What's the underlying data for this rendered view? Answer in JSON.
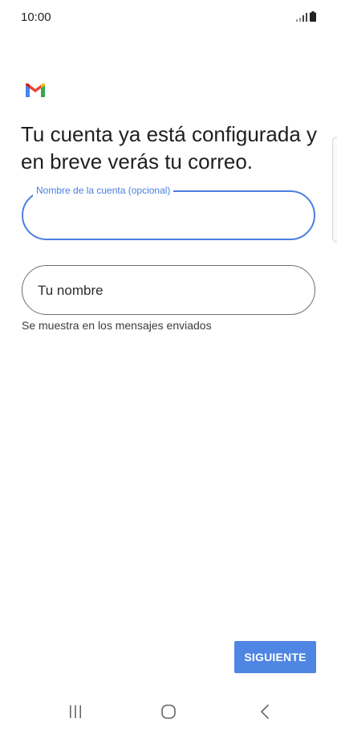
{
  "status_bar": {
    "time": "10:00",
    "icons": [
      "signal-icon",
      "battery-icon"
    ]
  },
  "app": {
    "logo": "gmail-logo-icon",
    "brand_colors": {
      "red": "#EA4335",
      "blue": "#4285F4",
      "green": "#34A853",
      "yellow": "#FBBC04"
    }
  },
  "main": {
    "headline": "Tu cuenta ya está configurada y en breve verás tu correo.",
    "account_field": {
      "label": "Nombre de la cuenta (opcional)",
      "value": ""
    },
    "name_field": {
      "placeholder": "Tu nombre",
      "value": "",
      "helper": "Se muestra en los mensajes enviados"
    },
    "next_button": "SIGUIENTE"
  },
  "nav_bar": {
    "buttons": [
      "recents-icon",
      "home-icon",
      "back-icon"
    ]
  },
  "colors": {
    "accent": "#4A7FE0",
    "button": "#4F86E3"
  }
}
